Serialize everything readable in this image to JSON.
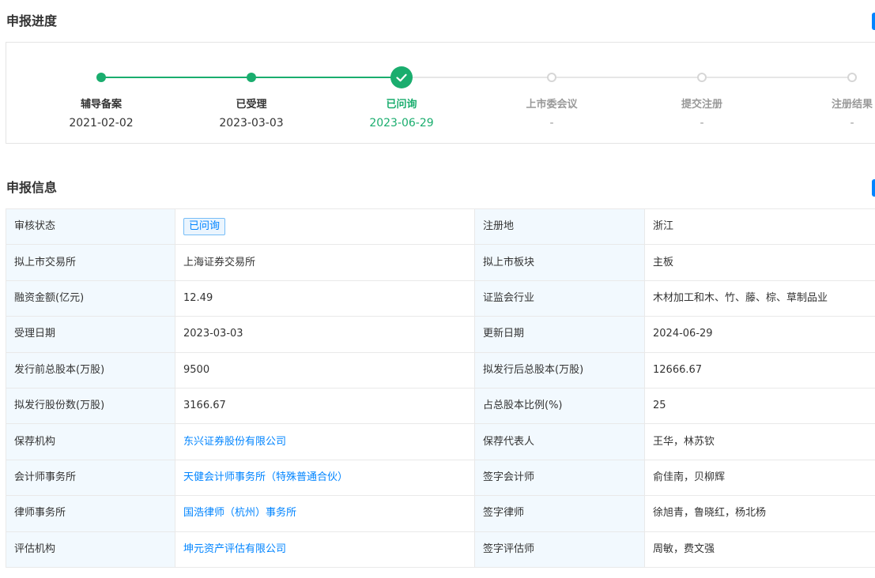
{
  "progress": {
    "title": "申报进度",
    "steps": [
      {
        "name": "辅导备案",
        "date": "2021-02-02",
        "state": "done"
      },
      {
        "name": "已受理",
        "date": "2023-03-03",
        "state": "done"
      },
      {
        "name": "已问询",
        "date": "2023-06-29",
        "state": "current"
      },
      {
        "name": "上市委会议",
        "date": "-",
        "state": "todo"
      },
      {
        "name": "提交注册",
        "date": "-",
        "state": "todo"
      },
      {
        "name": "注册结果",
        "date": "-",
        "state": "todo"
      }
    ]
  },
  "info": {
    "title": "申报信息",
    "rows": [
      {
        "l1": "审核状态",
        "v1": "已问询",
        "v1_type": "tag",
        "l2": "注册地",
        "v2": "浙江"
      },
      {
        "l1": "拟上市交易所",
        "v1": "上海证券交易所",
        "v1_type": "text",
        "l2": "拟上市板块",
        "v2": "主板"
      },
      {
        "l1": "融资金额(亿元)",
        "v1": "12.49",
        "v1_type": "text",
        "l2": "证监会行业",
        "v2": "木材加工和木、竹、藤、棕、草制品业"
      },
      {
        "l1": "受理日期",
        "v1": "2023-03-03",
        "v1_type": "text",
        "l2": "更新日期",
        "v2": "2024-06-29"
      },
      {
        "l1": "发行前总股本(万股)",
        "v1": "9500",
        "v1_type": "text",
        "l2": "拟发行后总股本(万股)",
        "v2": "12666.67"
      },
      {
        "l1": "拟发行股份数(万股)",
        "v1": "3166.67",
        "v1_type": "text",
        "l2": "占总股本比例(%)",
        "v2": "25"
      },
      {
        "l1": "保荐机构",
        "v1": "东兴证券股份有限公司",
        "v1_type": "link",
        "l2": "保荐代表人",
        "v2": "王华，林苏钦"
      },
      {
        "l1": "会计师事务所",
        "v1": "天健会计师事务所（特殊普通合伙）",
        "v1_type": "link",
        "l2": "签字会计师",
        "v2": "俞佳南，贝柳辉"
      },
      {
        "l1": "律师事务所",
        "v1": "国浩律师（杭州）事务所",
        "v1_type": "link",
        "l2": "签字律师",
        "v2": "徐旭青，鲁晓红，杨北杨"
      },
      {
        "l1": "评估机构",
        "v1": "坤元资产评估有限公司",
        "v1_type": "link",
        "l2": "签字评估师",
        "v2": "周敏，费文强"
      }
    ]
  },
  "colors": {
    "accent_green": "#1aad6e",
    "link_blue": "#0084ff",
    "label_bg": "#f2f9fe"
  }
}
